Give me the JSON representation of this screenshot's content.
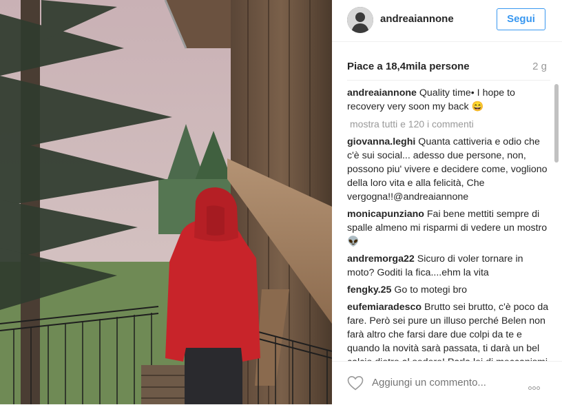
{
  "post": {
    "username": "andreaiannone",
    "follow_label": "Segui",
    "likes_text": "Piace a 18,4mila persone",
    "time_ago": "2 g",
    "caption": {
      "user": "andreaiannone",
      "text": "Quality time• I hope to recovery very soon my back 😄"
    },
    "show_more_label": "mostra tutti e 120 i commenti",
    "comments": [
      {
        "user": "giovanna.leghi",
        "text": "Quanta cattiveria e odio che c'è sui social... adesso due persone, non, possono piu' vivere e decidere come, vogliono della loro vita e alla felicità, Che vergogna!!@andreaiannone"
      },
      {
        "user": "monicapunziano",
        "text": "Fai bene mettiti sempre di spalle almeno mi risparmi di vedere un mostro 👽"
      },
      {
        "user": "andremorga22",
        "text": "Sicuro di voler tornare in moto? Goditi la fica....ehm la vita"
      },
      {
        "user": "fengky.25",
        "text": "Go to motegi bro"
      },
      {
        "user": "eufemiaradesco",
        "text": "Brutto sei brutto, c'è poco da fare. Però sei pure un illuso perché Belen non farà altro che farsi dare due colpi da te e quando la novità sarà passata, ti darà un bel calcio dietro al sedere! Parla lei di meccanismi di"
      }
    ],
    "add_comment_placeholder": "Aggiungi un commento..."
  },
  "icons": {
    "heart": "heart-icon",
    "more": "more-options-icon"
  },
  "colors": {
    "accent": "#3897f0",
    "muted": "#999999",
    "text": "#262626",
    "hood": "#c8242a"
  }
}
